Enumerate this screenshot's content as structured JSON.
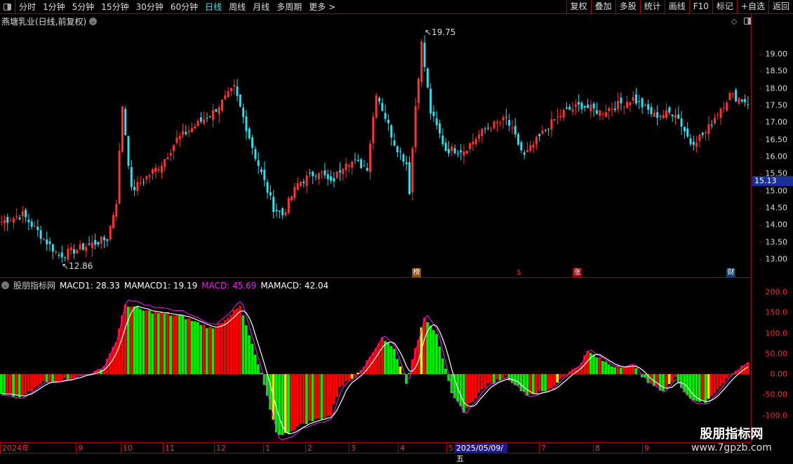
{
  "toolbar": {
    "periods": [
      "分时",
      "1分钟",
      "5分钟",
      "15分钟",
      "30分钟",
      "60分钟",
      "日线",
      "周线",
      "月线",
      "多周期",
      "更多 >"
    ],
    "active": "日线",
    "right": [
      "复权",
      "叠加",
      "多股",
      "统计",
      "画线",
      "F10",
      "标记",
      "+自选",
      "返回"
    ]
  },
  "stock_title": "燕塘乳业(日线,前复权)",
  "price_axis": [
    "19.00",
    "18.50",
    "18.00",
    "17.50",
    "17.00",
    "16.50",
    "16.00",
    "15.50",
    "15.00",
    "14.50",
    "14.00",
    "13.50",
    "13.00"
  ],
  "current_price": "15.13",
  "annotations": {
    "high": "19.75",
    "low": "12.86"
  },
  "event_tags": [
    {
      "text": "榜",
      "color": "#8a4a10"
    },
    {
      "text": "$",
      "color": "#000"
    },
    {
      "text": "涨",
      "color": "#8a0000"
    },
    {
      "text": "财",
      "color": "#123a70"
    }
  ],
  "indicator": {
    "name": "股朋指标网",
    "macd1": "MACD1: 28.33",
    "mamacd1": "MAMACD1: 19.19",
    "macd": "MACD: 45.69",
    "mamacd": "MAMACD: 42.04"
  },
  "macd_axis": [
    "200.0",
    "150.0",
    "100.0",
    "50.00",
    "0.00",
    "-50.00",
    "-100.0"
  ],
  "x_axis": [
    "2024年",
    "9",
    "10",
    "11",
    "12",
    "1",
    "2",
    "3",
    "4",
    "5",
    "7",
    "8",
    "9"
  ],
  "selected_date": "2025/05/09/五",
  "watermark": {
    "name": "股朋指标网",
    "url": "www.7gpzb.com"
  },
  "colors": {
    "up": "#ff3333",
    "down": "#33ddee",
    "hist_up": "#ff0000",
    "hist_down": "#00ee00",
    "macd": "#ee22ee",
    "mamacd": "#ffffff"
  },
  "chart_data": {
    "type": "candlestick+macd",
    "bars": 248,
    "price_keypoints": [
      [
        0,
        14.1
      ],
      [
        7,
        14.3
      ],
      [
        19,
        13.1
      ],
      [
        35,
        13.6
      ],
      [
        38,
        14.7
      ],
      [
        40,
        17.5
      ],
      [
        43,
        15.0
      ],
      [
        53,
        15.8
      ],
      [
        58,
        16.5
      ],
      [
        70,
        17.3
      ],
      [
        77,
        18.0
      ],
      [
        84,
        16.0
      ],
      [
        90,
        14.5
      ],
      [
        93,
        14.3
      ],
      [
        98,
        15.2
      ],
      [
        105,
        15.6
      ],
      [
        109,
        15.2
      ],
      [
        114,
        15.9
      ],
      [
        121,
        15.7
      ],
      [
        124,
        17.9
      ],
      [
        130,
        16.4
      ],
      [
        134,
        15.8
      ],
      [
        135,
        15.0
      ],
      [
        137,
        17.5
      ],
      [
        139,
        19.3
      ],
      [
        142,
        17.3
      ],
      [
        147,
        16.2
      ],
      [
        153,
        16.2
      ],
      [
        160,
        16.8
      ],
      [
        167,
        17.1
      ],
      [
        173,
        16.0
      ],
      [
        181,
        16.9
      ],
      [
        186,
        17.3
      ],
      [
        192,
        17.5
      ],
      [
        198,
        17.3
      ],
      [
        209,
        17.7
      ],
      [
        216,
        17.2
      ],
      [
        223,
        17.3
      ],
      [
        228,
        16.4
      ],
      [
        233,
        16.7
      ],
      [
        237,
        17.3
      ],
      [
        241,
        17.8
      ],
      [
        247,
        17.6
      ]
    ],
    "price_range": [
      12.6,
      20.0
    ],
    "hist_keypoints": [
      [
        0,
        -50
      ],
      [
        7,
        -55
      ],
      [
        14,
        -20
      ],
      [
        23,
        -10
      ],
      [
        33,
        10
      ],
      [
        38,
        80
      ],
      [
        41,
        170
      ],
      [
        47,
        155
      ],
      [
        60,
        140
      ],
      [
        70,
        110
      ],
      [
        79,
        165
      ],
      [
        86,
        0
      ],
      [
        91,
        -140
      ],
      [
        93,
        -150
      ],
      [
        100,
        -120
      ],
      [
        109,
        -100
      ],
      [
        112,
        -30
      ],
      [
        116,
        -10
      ],
      [
        121,
        30
      ],
      [
        126,
        90
      ],
      [
        130,
        60
      ],
      [
        134,
        -20
      ],
      [
        137,
        60
      ],
      [
        140,
        140
      ],
      [
        144,
        100
      ],
      [
        149,
        -50
      ],
      [
        153,
        -90
      ],
      [
        160,
        -30
      ],
      [
        167,
        -5
      ],
      [
        174,
        -50
      ],
      [
        181,
        -40
      ],
      [
        186,
        -5
      ],
      [
        191,
        20
      ],
      [
        194,
        55
      ],
      [
        202,
        20
      ],
      [
        209,
        20
      ],
      [
        214,
        -20
      ],
      [
        219,
        -40
      ],
      [
        223,
        -10
      ],
      [
        228,
        -60
      ],
      [
        233,
        -70
      ],
      [
        240,
        -10
      ],
      [
        247,
        30
      ]
    ],
    "macd_range": [
      -135,
      235
    ]
  }
}
